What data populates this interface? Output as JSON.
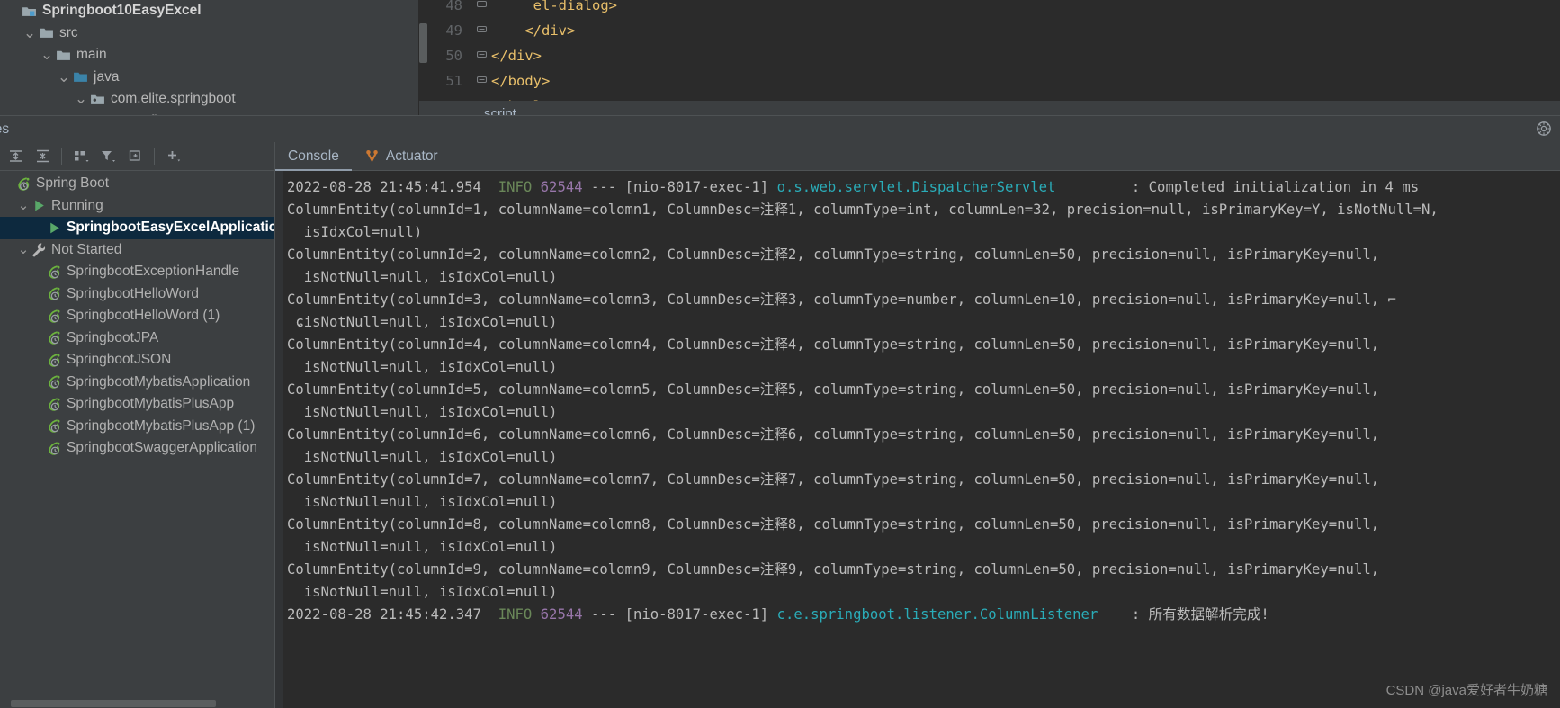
{
  "project_tree": {
    "rows": [
      {
        "indent": 0,
        "chevron": "",
        "icon": "module-icon",
        "label": "Springboot10EasyExcel",
        "bold": true
      },
      {
        "indent": 1,
        "chevron": "v",
        "icon": "folder-icon",
        "label": "src",
        "bold": false
      },
      {
        "indent": 2,
        "chevron": "v",
        "icon": "folder-icon",
        "label": "main",
        "bold": false
      },
      {
        "indent": 3,
        "chevron": "v",
        "icon": "source-folder-icon",
        "label": "java",
        "bold": false
      },
      {
        "indent": 4,
        "chevron": "v",
        "icon": "package-icon",
        "label": "com.elite.springboot",
        "bold": false
      },
      {
        "indent": 5,
        "chevron": "",
        "icon": "package-icon",
        "label": "config",
        "bold": false
      }
    ]
  },
  "editor": {
    "lines": [
      {
        "num": "48",
        "fold": "-",
        "indent": 5,
        "text": "</el-dialog>",
        "highlight": "el-dialog"
      },
      {
        "num": "49",
        "fold": "o",
        "indent": 4,
        "text": "</div>",
        "highlight": ""
      },
      {
        "num": "50",
        "fold": "o",
        "indent": 0,
        "text": "</div>",
        "highlight": ""
      },
      {
        "num": "51",
        "fold": "o",
        "indent": 0,
        "text": "</body>",
        "highlight": ""
      }
    ],
    "breadcrumb": "script"
  },
  "services_header": {
    "title": "ces"
  },
  "services_toolbar": {
    "buttons": [
      {
        "name": "expand-all-icon",
        "glyph": "expand"
      },
      {
        "name": "collapse-all-icon",
        "glyph": "collapse"
      },
      {
        "name": "group-by-icon",
        "glyph": "group"
      },
      {
        "name": "filter-icon",
        "glyph": "filter"
      },
      {
        "name": "add-tab-icon",
        "glyph": "addtab"
      },
      {
        "name": "add-service-icon",
        "glyph": "plus"
      }
    ]
  },
  "services_tree": {
    "rows": [
      {
        "indent": 0,
        "arrow": "",
        "icon": "spring-boot-icon",
        "label": "Spring Boot",
        "selected": false
      },
      {
        "indent": 1,
        "arrow": "v",
        "icon": "run-icon",
        "label": "Running",
        "selected": false
      },
      {
        "indent": 2,
        "arrow": "",
        "icon": "run-icon",
        "label": "SpringbootEasyExcelApplication",
        "selected": true
      },
      {
        "indent": 1,
        "arrow": "v",
        "icon": "wrench-icon",
        "label": "Not Started",
        "selected": false
      },
      {
        "indent": 2,
        "arrow": "",
        "icon": "spring-config-icon",
        "label": "SpringbootExceptionHandle",
        "selected": false
      },
      {
        "indent": 2,
        "arrow": "",
        "icon": "spring-config-icon",
        "label": "SpringbootHelloWord",
        "selected": false
      },
      {
        "indent": 2,
        "arrow": "",
        "icon": "spring-config-icon",
        "label": "SpringbootHelloWord (1)",
        "selected": false
      },
      {
        "indent": 2,
        "arrow": "",
        "icon": "spring-config-icon",
        "label": "SpringbootJPA",
        "selected": false
      },
      {
        "indent": 2,
        "arrow": "",
        "icon": "spring-config-icon",
        "label": "SpringbootJSON",
        "selected": false
      },
      {
        "indent": 2,
        "arrow": "",
        "icon": "spring-config-icon",
        "label": "SpringbootMybatisApplication",
        "selected": false
      },
      {
        "indent": 2,
        "arrow": "",
        "icon": "spring-config-icon",
        "label": "SpringbootMybatisPlusApp",
        "selected": false
      },
      {
        "indent": 2,
        "arrow": "",
        "icon": "spring-config-icon",
        "label": "SpringbootMybatisPlusApp (1)",
        "selected": false
      },
      {
        "indent": 2,
        "arrow": "",
        "icon": "spring-config-icon",
        "label": "SpringbootSwaggerApplication",
        "selected": false
      }
    ]
  },
  "console_tabs": [
    {
      "label": "Console",
      "icon": "",
      "active": true
    },
    {
      "label": "Actuator",
      "icon": "actuator-icon",
      "active": false
    }
  ],
  "console_log": {
    "lines": [
      {
        "type": "spring",
        "timestamp": "2022-08-28 21:45:41.954",
        "level": "INFO",
        "pid": "62544",
        "dashes": "---",
        "thread": "[nio-8017-exec-1]",
        "logger": "o.s.web.servlet.DispatcherServlet",
        "logger_pad": 9,
        "message": ": Completed initialization in 4 ms"
      },
      {
        "type": "plain",
        "text": "ColumnEntity(columnId=1, columnName=colomn1, ColumnDesc=注释1, columnType=int, columnLen=32, precision=null, isPrimaryKey=Y, isNotNull=N,"
      },
      {
        "type": "plain",
        "text": "  isIdxCol=null)"
      },
      {
        "type": "plain",
        "text": "ColumnEntity(columnId=2, columnName=colomn2, ColumnDesc=注释2, columnType=string, columnLen=50, precision=null, isPrimaryKey=null,"
      },
      {
        "type": "plain",
        "text": "  isNotNull=null, isIdxCol=null)"
      },
      {
        "type": "plain",
        "text": "ColumnEntity(columnId=3, columnName=colomn3, ColumnDesc=注释3, columnType=number, columnLen=10, precision=null, isPrimaryKey=null, ⌐"
      },
      {
        "type": "plain",
        "text": " ɕisNotNull=null, isIdxCol=null)"
      },
      {
        "type": "plain",
        "text": "ColumnEntity(columnId=4, columnName=colomn4, ColumnDesc=注释4, columnType=string, columnLen=50, precision=null, isPrimaryKey=null,"
      },
      {
        "type": "plain",
        "text": "  isNotNull=null, isIdxCol=null)"
      },
      {
        "type": "plain",
        "text": "ColumnEntity(columnId=5, columnName=colomn5, ColumnDesc=注释5, columnType=string, columnLen=50, precision=null, isPrimaryKey=null,"
      },
      {
        "type": "plain",
        "text": "  isNotNull=null, isIdxCol=null)"
      },
      {
        "type": "plain",
        "text": "ColumnEntity(columnId=6, columnName=colomn6, ColumnDesc=注释6, columnType=string, columnLen=50, precision=null, isPrimaryKey=null,"
      },
      {
        "type": "plain",
        "text": "  isNotNull=null, isIdxCol=null)"
      },
      {
        "type": "plain",
        "text": "ColumnEntity(columnId=7, columnName=colomn7, ColumnDesc=注释7, columnType=string, columnLen=50, precision=null, isPrimaryKey=null,"
      },
      {
        "type": "plain",
        "text": "  isNotNull=null, isIdxCol=null)"
      },
      {
        "type": "plain",
        "text": "ColumnEntity(columnId=8, columnName=colomn8, ColumnDesc=注释8, columnType=string, columnLen=50, precision=null, isPrimaryKey=null,"
      },
      {
        "type": "plain",
        "text": "  isNotNull=null, isIdxCol=null)"
      },
      {
        "type": "plain",
        "text": "ColumnEntity(columnId=9, columnName=colomn9, ColumnDesc=注释9, columnType=string, columnLen=50, precision=null, isPrimaryKey=null,"
      },
      {
        "type": "plain",
        "text": "  isNotNull=null, isIdxCol=null)"
      },
      {
        "type": "spring",
        "timestamp": "2022-08-28 21:45:42.347",
        "level": "INFO",
        "pid": "62544",
        "dashes": "---",
        "thread": "[nio-8017-exec-1]",
        "logger": "c.e.springboot.listener.ColumnListener",
        "logger_pad": 4,
        "message": ": 所有数据解析完成!"
      }
    ]
  },
  "watermark": "CSDN @java爱好者牛奶糖",
  "colors": {
    "bg_panel": "#3c3f41",
    "bg_editor": "#2b2b2b",
    "selection": "#0d293e",
    "info_green": "#6a8759",
    "pid_purple": "#9876aa",
    "logger_cyan": "#2aacb8",
    "tag_orange": "#e8bf6a",
    "accent_orange": "#cc7832"
  }
}
